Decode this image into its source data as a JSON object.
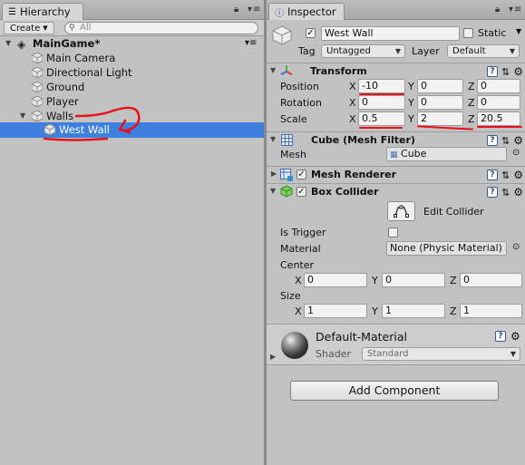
{
  "hierarchy": {
    "tab_label": "Hierarchy",
    "create_label": "Create",
    "search_placeholder": "All",
    "scene_name": "MainGame*",
    "items": [
      {
        "label": "Main Camera"
      },
      {
        "label": "Directional Light"
      },
      {
        "label": "Ground"
      },
      {
        "label": "Player"
      },
      {
        "label": "Walls"
      },
      {
        "label": "West Wall"
      }
    ]
  },
  "inspector": {
    "tab_label": "Inspector",
    "object_name": "West Wall",
    "static_label": "Static",
    "tag_label": "Tag",
    "tag_value": "Untagged",
    "layer_label": "Layer",
    "layer_value": "Default",
    "transform": {
      "title": "Transform",
      "position_label": "Position",
      "rotation_label": "Rotation",
      "scale_label": "Scale",
      "x_label": "X",
      "y_label": "Y",
      "z_label": "Z",
      "position": {
        "x": "-10",
        "y": "0",
        "z": "0"
      },
      "rotation": {
        "x": "0",
        "y": "0",
        "z": "0"
      },
      "scale": {
        "x": "0.5",
        "y": "2",
        "z": "20.5"
      }
    },
    "mesh_filter": {
      "title": "Cube (Mesh Filter)",
      "mesh_label": "Mesh",
      "mesh_value": "Cube"
    },
    "mesh_renderer": {
      "title": "Mesh Renderer"
    },
    "box_collider": {
      "title": "Box Collider",
      "edit_collider_label": "Edit Collider",
      "is_trigger_label": "Is Trigger",
      "material_label": "Material",
      "material_value": "None (Physic Material)",
      "center_label": "Center",
      "size_label": "Size",
      "center": {
        "x": "0",
        "y": "0",
        "z": "0"
      },
      "size": {
        "x": "1",
        "y": "1",
        "z": "1"
      }
    },
    "material": {
      "name": "Default-Material",
      "shader_label": "Shader",
      "shader_value": "Standard"
    },
    "add_component_label": "Add Component"
  },
  "colors": {
    "selection": "#3d80df",
    "annotation": "#e8121b",
    "panel_bg": "#c2c2c2"
  }
}
